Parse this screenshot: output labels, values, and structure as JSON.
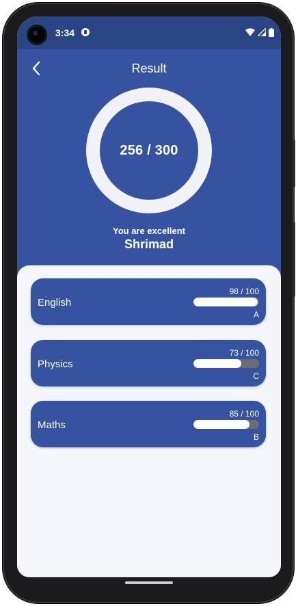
{
  "status_bar": {
    "time": "3:34",
    "icons": [
      "camera-cutout",
      "notification-icon",
      "wifi-icon",
      "signal-icon",
      "battery-icon"
    ]
  },
  "header": {
    "title": "Result",
    "score": "256 / 300",
    "tagline": "You are excellent",
    "student_name": "Shrimad"
  },
  "subjects": [
    {
      "name": "English",
      "marks": "98 / 100",
      "progress": 0.98,
      "grade": "A"
    },
    {
      "name": "Physics",
      "marks": "73 / 100",
      "progress": 0.73,
      "grade": "C"
    },
    {
      "name": "Maths",
      "marks": "85 / 100",
      "progress": 0.85,
      "grade": "B"
    }
  ],
  "colors": {
    "primary": "#3553a0",
    "status_bar": "#2a4584",
    "background": "#f5f6fa",
    "progress_track": "#6d6d71",
    "progress_fill": "#ffffff"
  }
}
